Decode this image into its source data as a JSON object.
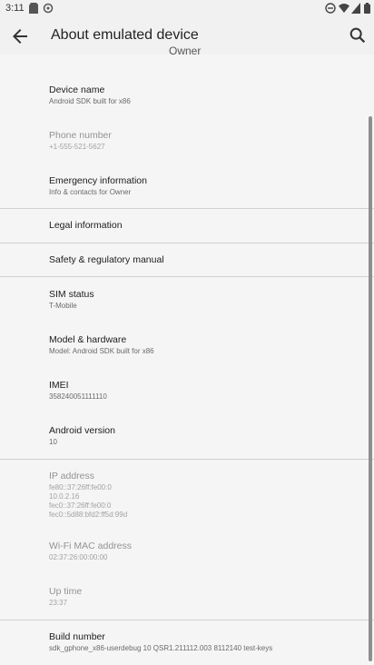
{
  "status_bar": {
    "time": "3:11"
  },
  "app_bar": {
    "title": "About emulated device"
  },
  "owner_fragment": "Owner",
  "items": [
    {
      "title": "Device name",
      "subtitle": "Android SDK built for x86"
    },
    {
      "title": "Phone number",
      "subtitle": "+1-555-521-5627"
    },
    {
      "title": "Emergency information",
      "subtitle": "Info & contacts for Owner"
    },
    {
      "title": "Legal information",
      "subtitle": ""
    },
    {
      "title": "Safety & regulatory manual",
      "subtitle": ""
    },
    {
      "title": "SIM status",
      "subtitle": "T-Mobile"
    },
    {
      "title": "Model & hardware",
      "subtitle": "Model: Android SDK built for x86"
    },
    {
      "title": "IMEI",
      "subtitle": "358240051111110"
    },
    {
      "title": "Android version",
      "subtitle": "10"
    },
    {
      "title": "IP address",
      "subtitle_lines": [
        "fe80::37:26ff:fe00:0",
        "10.0.2.16",
        "fec0::37:26ff:fe00:0",
        "fec0::5d88:bfd2:ff5d:99d"
      ]
    },
    {
      "title": "Wi-Fi MAC address",
      "subtitle": "02:37:26:00:00:00"
    },
    {
      "title": "Up time",
      "subtitle": "23:37"
    },
    {
      "title": "Build number",
      "subtitle": "sdk_gphone_x86-userdebug 10 QSR1.211112.003 8112140 test-keys"
    }
  ]
}
